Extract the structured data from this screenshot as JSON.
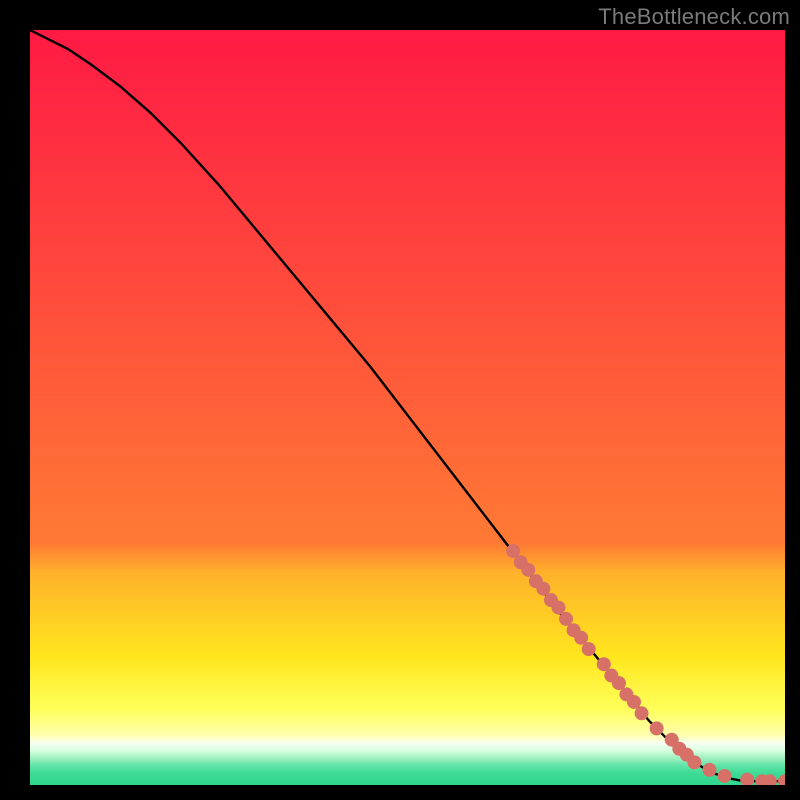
{
  "watermark": "TheBottleneck.com",
  "colors": {
    "bg": "#000000",
    "curve": "#000000",
    "dot": "#d77168",
    "watermark": "#7a7a7a"
  },
  "chart_data": {
    "type": "line",
    "title": "",
    "xlabel": "",
    "ylabel": "",
    "xlim": [
      0,
      100
    ],
    "ylim": [
      0,
      100
    ],
    "x": [
      0,
      2,
      5,
      8,
      12,
      16,
      20,
      25,
      30,
      35,
      40,
      45,
      50,
      55,
      60,
      65,
      70,
      75,
      80,
      82,
      84,
      86,
      88,
      90,
      92,
      94,
      96,
      98,
      100
    ],
    "y": [
      100,
      99,
      97.5,
      95.5,
      92.5,
      89,
      85,
      79.5,
      73.5,
      67.5,
      61.5,
      55.5,
      49,
      42.5,
      36,
      29.5,
      23,
      17,
      11,
      8.5,
      6.5,
      4.5,
      3,
      1.8,
      1.0,
      0.6,
      0.5,
      0.5,
      0.5
    ],
    "series_points": {
      "x": [
        64,
        65,
        66,
        67,
        68,
        69,
        70,
        71,
        72,
        73,
        74,
        76,
        77,
        78,
        79,
        80,
        81,
        83,
        85,
        86,
        87,
        88,
        90,
        92,
        95,
        97,
        98,
        100
      ],
      "y": [
        31,
        29.5,
        28.5,
        27,
        26,
        24.5,
        23.5,
        22,
        20.5,
        19.5,
        18,
        16,
        14.5,
        13.5,
        12,
        11,
        9.5,
        7.5,
        6,
        4.8,
        4,
        3,
        2,
        1.2,
        0.7,
        0.5,
        0.5,
        0.5
      ]
    },
    "gradient_bands": [
      {
        "y0": 0,
        "y1": 68,
        "c0": "#ff1a44",
        "c1": "#ff7a34"
      },
      {
        "y0": 68,
        "y1": 72,
        "c0": "#ff7a34",
        "c1": "#ffb22a"
      },
      {
        "y0": 72,
        "y1": 83,
        "c0": "#ffb22a",
        "c1": "#ffe61e"
      },
      {
        "y0": 83,
        "y1": 90,
        "c0": "#ffe61e",
        "c1": "#ffff5a"
      },
      {
        "y0": 90,
        "y1": 93.5,
        "c0": "#ffff5a",
        "c1": "#ffffb0"
      },
      {
        "y0": 93.5,
        "y1": 94.5,
        "c0": "#ffffb0",
        "c1": "#f6fff0"
      },
      {
        "y0": 94.5,
        "y1": 95.5,
        "c0": "#f6fff0",
        "c1": "#d8ffe0"
      },
      {
        "y0": 95.5,
        "y1": 96.5,
        "c0": "#d8ffe0",
        "c1": "#9ff0c0"
      },
      {
        "y0": 96.5,
        "y1": 97.5,
        "c0": "#9ff0c0",
        "c1": "#5fe4a8"
      },
      {
        "y0": 97.5,
        "y1": 98.5,
        "c0": "#5fe4a8",
        "c1": "#3edb96"
      },
      {
        "y0": 98.5,
        "y1": 100,
        "c0": "#3edb96",
        "c1": "#2fd78e"
      }
    ]
  }
}
